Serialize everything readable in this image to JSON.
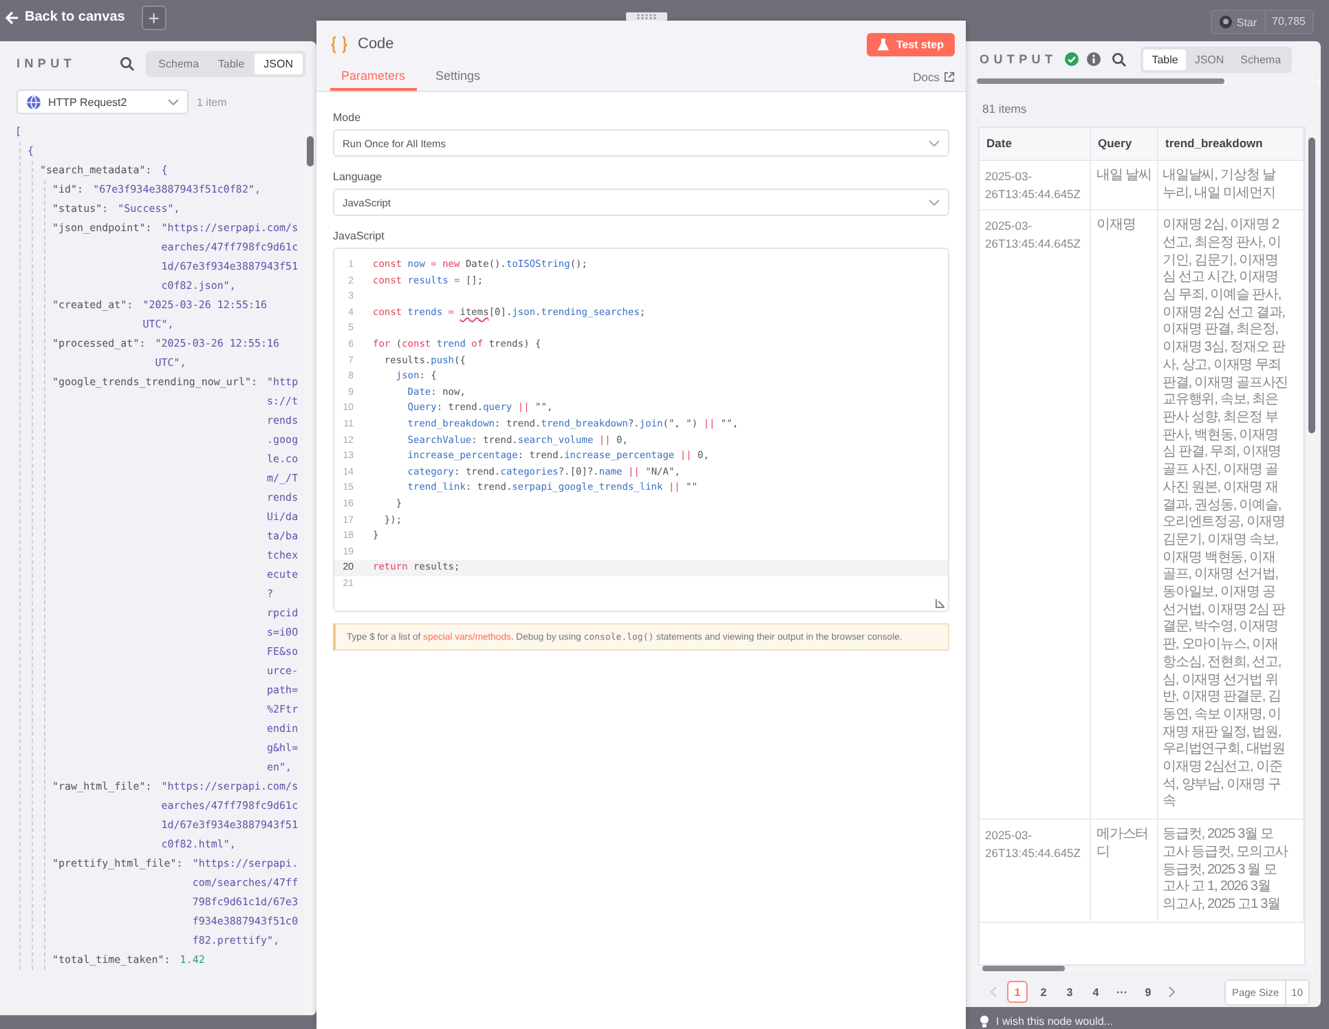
{
  "canvas": {
    "back_link": "Back to canvas",
    "add_button": "+",
    "star_button": "Star",
    "star_count": "70,785",
    "feedback": "I wish this node would..."
  },
  "input_panel": {
    "title": "INPUT",
    "tabs": [
      {
        "label": "Schema",
        "selected": false
      },
      {
        "label": "Table",
        "selected": false
      },
      {
        "label": "JSON",
        "selected": true
      }
    ],
    "source": "HTTP Request2",
    "item_count": "1 item",
    "json_tree": [
      {
        "value": "[",
        "kind": "bracket",
        "children": [
          {
            "value": "{",
            "kind": "bracket",
            "children": [
              {
                "key": "\"search_metadata\":",
                "value": "{",
                "kind": "bracket",
                "children": [
                  {
                    "key": "\"id\":",
                    "value": "\"67e3f934e3887943f51c0f82\",",
                    "kind": "string"
                  },
                  {
                    "key": "\"status\":",
                    "value": "\"Success\",",
                    "kind": "string"
                  },
                  {
                    "key": "\"json_endpoint\":",
                    "value": "\"https://serpapi.com/searches/47ff798fc9d61c1d/67e3f934e3887943f51c0f82.json\",",
                    "kind": "string"
                  },
                  {
                    "key": "\"created_at\":",
                    "value": "\"2025-03-26 12:55:16 UTC\",",
                    "kind": "string"
                  },
                  {
                    "key": "\"processed_at\":",
                    "value": "\"2025-03-26 12:55:16 UTC\",",
                    "kind": "string"
                  },
                  {
                    "key": "\"google_trends_trending_now_url\":",
                    "value": "\"https://trends.google.com/_/TrendsUi/data/batchexecute?rpcids=i0OFE&source-path=%2Ftrending&hl=en\",",
                    "kind": "string"
                  },
                  {
                    "key": "\"raw_html_file\":",
                    "value": "\"https://serpapi.com/searches/47ff798fc9d61c1d/67e3f934e3887943f51c0f82.html\",",
                    "kind": "string"
                  },
                  {
                    "key": "\"prettify_html_file\":",
                    "value": "\"https://serpapi.com/searches/47ff798fc9d61c1d/67e3f934e3887943f51c0f82.prettify\",",
                    "kind": "string"
                  },
                  {
                    "key": "\"total_time_taken\":",
                    "value": "1.42",
                    "kind": "number"
                  }
                ]
              }
            ]
          }
        ]
      }
    ]
  },
  "node": {
    "title": "Code",
    "test_button": "Test step",
    "tabs": [
      {
        "label": "Parameters",
        "selected": true
      },
      {
        "label": "Settings",
        "selected": false
      }
    ],
    "docs_link": "Docs",
    "fields": [
      {
        "label": "Mode",
        "value": "Run Once for All Items"
      },
      {
        "label": "Language",
        "value": "JavaScript"
      }
    ],
    "code_label": "JavaScript",
    "code_lines": [
      {
        "number": "1",
        "active": false,
        "tokens": [
          {
            "kind": "keyword",
            "text": "const "
          },
          {
            "kind": "name",
            "text": "now"
          },
          {
            "kind": "keyword",
            "text": " = new "
          },
          {
            "kind": "plain",
            "text": "Date()."
          },
          {
            "kind": "name",
            "text": "toISOString"
          },
          {
            "kind": "plain",
            "text": "();"
          }
        ]
      },
      {
        "number": "2",
        "active": false,
        "tokens": [
          {
            "kind": "keyword",
            "text": "const "
          },
          {
            "kind": "name",
            "text": "results"
          },
          {
            "kind": "keyword",
            "text": " = "
          },
          {
            "kind": "plain",
            "text": "[];"
          }
        ]
      },
      {
        "number": "3",
        "active": false
      },
      {
        "number": "4",
        "active": false,
        "tokens": [
          {
            "kind": "keyword",
            "text": "const "
          },
          {
            "kind": "name",
            "text": "trends"
          },
          {
            "kind": "keyword",
            "text": " = "
          },
          {
            "kind": "error",
            "text": "items"
          },
          {
            "kind": "plain",
            "text": "[0]."
          },
          {
            "kind": "name",
            "text": "json.trending_searches"
          },
          {
            "kind": "plain",
            "text": ";"
          }
        ]
      },
      {
        "number": "5",
        "active": false
      },
      {
        "number": "6",
        "active": false,
        "tokens": [
          {
            "kind": "keyword",
            "text": "for "
          },
          {
            "kind": "plain",
            "text": "("
          },
          {
            "kind": "keyword",
            "text": "const "
          },
          {
            "kind": "name",
            "text": "trend "
          },
          {
            "kind": "keyword",
            "text": "of "
          },
          {
            "kind": "plain",
            "text": "trends) {"
          }
        ]
      },
      {
        "number": "7",
        "active": false,
        "tokens": [
          {
            "kind": "plain",
            "text": "  results."
          },
          {
            "kind": "name",
            "text": "push"
          },
          {
            "kind": "plain",
            "text": "({"
          }
        ]
      },
      {
        "number": "8",
        "active": false,
        "tokens": [
          {
            "kind": "name",
            "text": "    json"
          },
          {
            "kind": "plain",
            "text": ": {"
          }
        ]
      },
      {
        "number": "9",
        "active": false,
        "tokens": [
          {
            "kind": "name",
            "text": "      Date"
          },
          {
            "kind": "plain",
            "text": ": now,"
          }
        ]
      },
      {
        "number": "10",
        "active": false,
        "tokens": [
          {
            "kind": "name",
            "text": "      Query"
          },
          {
            "kind": "plain",
            "text": ": trend."
          },
          {
            "kind": "name",
            "text": "query"
          },
          {
            "kind": "keyword",
            "text": " || "
          },
          {
            "kind": "plain",
            "text": "\"\","
          }
        ]
      },
      {
        "number": "11",
        "active": false,
        "tokens": [
          {
            "kind": "name",
            "text": "      trend_breakdown"
          },
          {
            "kind": "plain",
            "text": ": trend."
          },
          {
            "kind": "name",
            "text": "trend_breakdown"
          },
          {
            "kind": "plain",
            "text": "?."
          },
          {
            "kind": "name",
            "text": "join"
          },
          {
            "kind": "plain",
            "text": "(\", \")"
          },
          {
            "kind": "keyword",
            "text": " || "
          },
          {
            "kind": "plain",
            "text": "\"\","
          }
        ]
      },
      {
        "number": "12",
        "active": false,
        "tokens": [
          {
            "kind": "name",
            "text": "      SearchValue"
          },
          {
            "kind": "plain",
            "text": ": trend."
          },
          {
            "kind": "name",
            "text": "search_volume"
          },
          {
            "kind": "keyword",
            "text": " || "
          },
          {
            "kind": "plain",
            "text": "0,"
          }
        ]
      },
      {
        "number": "13",
        "active": false,
        "tokens": [
          {
            "kind": "name",
            "text": "      increase_percentage"
          },
          {
            "kind": "plain",
            "text": ": trend."
          },
          {
            "kind": "name",
            "text": "increase_percentage"
          },
          {
            "kind": "keyword",
            "text": " || "
          },
          {
            "kind": "plain",
            "text": "0,"
          }
        ]
      },
      {
        "number": "14",
        "active": false,
        "tokens": [
          {
            "kind": "name",
            "text": "      category"
          },
          {
            "kind": "plain",
            "text": ": trend."
          },
          {
            "kind": "name",
            "text": "categories"
          },
          {
            "kind": "plain",
            "text": "?.[0]?."
          },
          {
            "kind": "name",
            "text": "name"
          },
          {
            "kind": "keyword",
            "text": " || "
          },
          {
            "kind": "plain",
            "text": "\"N/A\","
          }
        ]
      },
      {
        "number": "15",
        "active": false,
        "tokens": [
          {
            "kind": "name",
            "text": "      trend_link"
          },
          {
            "kind": "plain",
            "text": ": trend."
          },
          {
            "kind": "name",
            "text": "serpapi_google_trends_link"
          },
          {
            "kind": "keyword",
            "text": " || "
          },
          {
            "kind": "plain",
            "text": "\"\""
          }
        ]
      },
      {
        "number": "16",
        "active": false,
        "tokens": [
          {
            "kind": "plain",
            "text": "    }"
          }
        ]
      },
      {
        "number": "17",
        "active": false,
        "tokens": [
          {
            "kind": "plain",
            "text": "  });"
          }
        ]
      },
      {
        "number": "18",
        "active": false,
        "tokens": [
          {
            "kind": "plain",
            "text": "}"
          }
        ]
      },
      {
        "number": "19",
        "active": false
      },
      {
        "number": "20",
        "active": true,
        "tokens": [
          {
            "kind": "keyword",
            "text": "return "
          },
          {
            "kind": "plain",
            "text": "results;"
          }
        ]
      },
      {
        "number": "21",
        "active": false
      }
    ],
    "hint": [
      {
        "kind": "text",
        "text": "Type $ for a list of "
      },
      {
        "kind": "link",
        "text": "special vars/methods"
      },
      {
        "kind": "text",
        "text": ". Debug by using "
      },
      {
        "kind": "code",
        "text": "console.log()"
      },
      {
        "kind": "text",
        "text": " statements and viewing their output in the browser console."
      }
    ]
  },
  "output_panel": {
    "title": "OUTPUT",
    "success": true,
    "tabs": [
      {
        "label": "Table",
        "selected": true
      },
      {
        "label": "JSON",
        "selected": false
      },
      {
        "label": "Schema",
        "selected": false
      }
    ],
    "item_count": "81 items",
    "table": {
      "columns": [
        "Date",
        "Query",
        "trend_breakdown"
      ],
      "rows": [
        [
          "2025-03-\n26T13:45:44.645Z",
          "내일 날씨",
          "내일날씨, 기상청 날\n누리, 내일 미세먼지"
        ],
        [
          "2025-03-\n26T13:45:44.645Z",
          "이재명",
          "이재명 2심, 이재명 2\n선고, 최은정 판사, 이\n기인, 김문기, 이재명\n심 선고 시간, 이재명\n심 무죄, 이예슬 판사,\n이재명 2심 선고 결과,\n이재명 판결, 최은정,\n이재명 3심, 정재오 판\n사, 상고, 이재명 무죄\n판결, 이재명 골프사진\n교유행위, 속보, 최은\n판사 성향, 최은정 부\n판사, 백현동, 이재명\n심 판결, 무죄, 이재명\n골프 사진, 이재명 골\n사진 원본, 이재명 재\n결과, 권성동, 이예슬,\n오리엔트정공, 이재명\n김문기, 이재명 속보,\n이재명 백현동, 이재\n골프, 이재명 선거법,\n동아일보, 이재명 공\n선거법, 이재명 2심 판\n결문, 박수영, 이재명\n판, 오마이뉴스, 이재\n항소심, 전현희, 선고,\n심, 이재명 선거법 위\n반, 이재명 판결문, 김\n동연, 속보 이재명, 이\n재명 재판 일정, 법원,\n우리법연구회, 대법원\n이재명 2심선고, 이준\n석, 양부남, 이재명 구\n속"
        ],
        [
          "2025-03-\n26T13:45:44.645Z",
          "메가스터디",
          "등급컷, 2025 3월 모\n고사 등급컷, 모의고사\n등급컷, 2025 3 월 모\n고사 고 1, 2026 3월\n의고사, 2025 고1 3월"
        ]
      ]
    },
    "pagination": {
      "prev_disabled": true,
      "pages": [
        {
          "label": "1",
          "selected": true
        },
        {
          "label": "2",
          "selected": false
        },
        {
          "label": "3",
          "selected": false
        },
        {
          "label": "4",
          "selected": false
        },
        {
          "label": "···",
          "selected": false
        },
        {
          "label": "9",
          "selected": false
        }
      ],
      "page_size_label": "Page Size",
      "page_size": "10"
    }
  }
}
